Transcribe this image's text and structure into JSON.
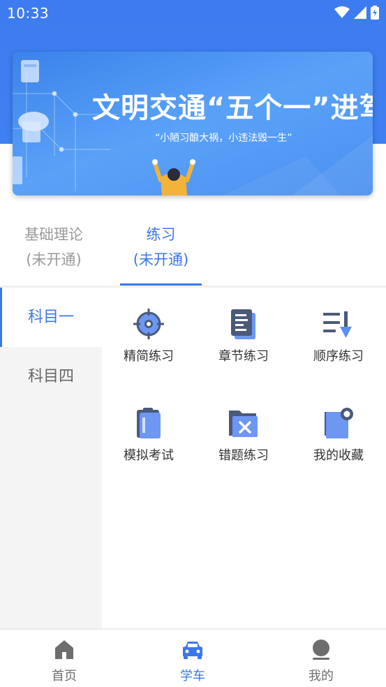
{
  "status_bar": {
    "time": "10:33"
  },
  "banner": {
    "title": "文明交通“五个一”进驾校",
    "subtitle": "“小陋习酿大祸，小违法毁一生”"
  },
  "tabs": [
    {
      "label": "基础理论",
      "sublabel": "(未开通)",
      "active": false
    },
    {
      "label": "练习",
      "sublabel": "(未开通)",
      "active": true
    }
  ],
  "side_menu": [
    {
      "label": "科目一",
      "active": true
    },
    {
      "label": "科目四",
      "active": false
    }
  ],
  "grid": [
    {
      "label": "精简练习",
      "icon": "target-icon"
    },
    {
      "label": "章节练习",
      "icon": "document-icon"
    },
    {
      "label": "顺序练习",
      "icon": "sort-icon"
    },
    {
      "label": "模拟考试",
      "icon": "clipboard-icon"
    },
    {
      "label": "错题练习",
      "icon": "folder-x-icon"
    },
    {
      "label": "我的收藏",
      "icon": "favorite-icon"
    }
  ],
  "bottom_nav": [
    {
      "label": "首页",
      "icon": "home-icon",
      "active": false
    },
    {
      "label": "学车",
      "icon": "car-icon",
      "active": true
    },
    {
      "label": "我的",
      "icon": "user-icon",
      "active": false
    }
  ],
  "colors": {
    "accent": "#3a78e8",
    "header": "#3f80f2",
    "inactive": "#888888",
    "icon_blue": "#5b8ff2",
    "icon_dark": "#4a5a7a"
  }
}
